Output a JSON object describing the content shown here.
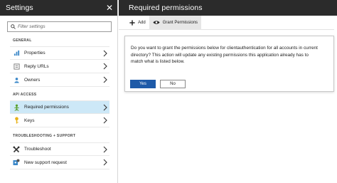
{
  "left": {
    "title": "Settings",
    "search_placeholder": "Filter settings",
    "groups": [
      {
        "label": "GENERAL",
        "items": [
          {
            "label": "Properties"
          },
          {
            "label": "Reply URLs"
          },
          {
            "label": "Owners"
          }
        ]
      },
      {
        "label": "API ACCESS",
        "items": [
          {
            "label": "Required permissions"
          },
          {
            "label": "Keys"
          }
        ]
      },
      {
        "label": "TROUBLESHOOTING + SUPPORT",
        "items": [
          {
            "label": "Troubleshoot"
          },
          {
            "label": "New support request"
          }
        ]
      }
    ]
  },
  "right": {
    "title": "Required permissions",
    "toolbar": {
      "add": "Add",
      "grant": "Grant Permissions"
    },
    "dialog": {
      "message": "Do you want to grant the permissions below for clientauthentication for all accounts in current directory? This action will update any existing permissions this application already has to match what is listed below.",
      "yes": "Yes",
      "no": "No"
    }
  },
  "colors": {
    "header_bg": "#2b2b2b",
    "active_item": "#cde8f7",
    "primary_button": "#1e5aa8"
  },
  "icons": [
    "close-icon",
    "search-icon",
    "properties-icon",
    "reply-urls-icon",
    "owners-icon",
    "required-permissions-icon",
    "keys-icon",
    "troubleshoot-icon",
    "support-request-icon",
    "chevron-right-icon",
    "add-icon",
    "eye-icon"
  ]
}
